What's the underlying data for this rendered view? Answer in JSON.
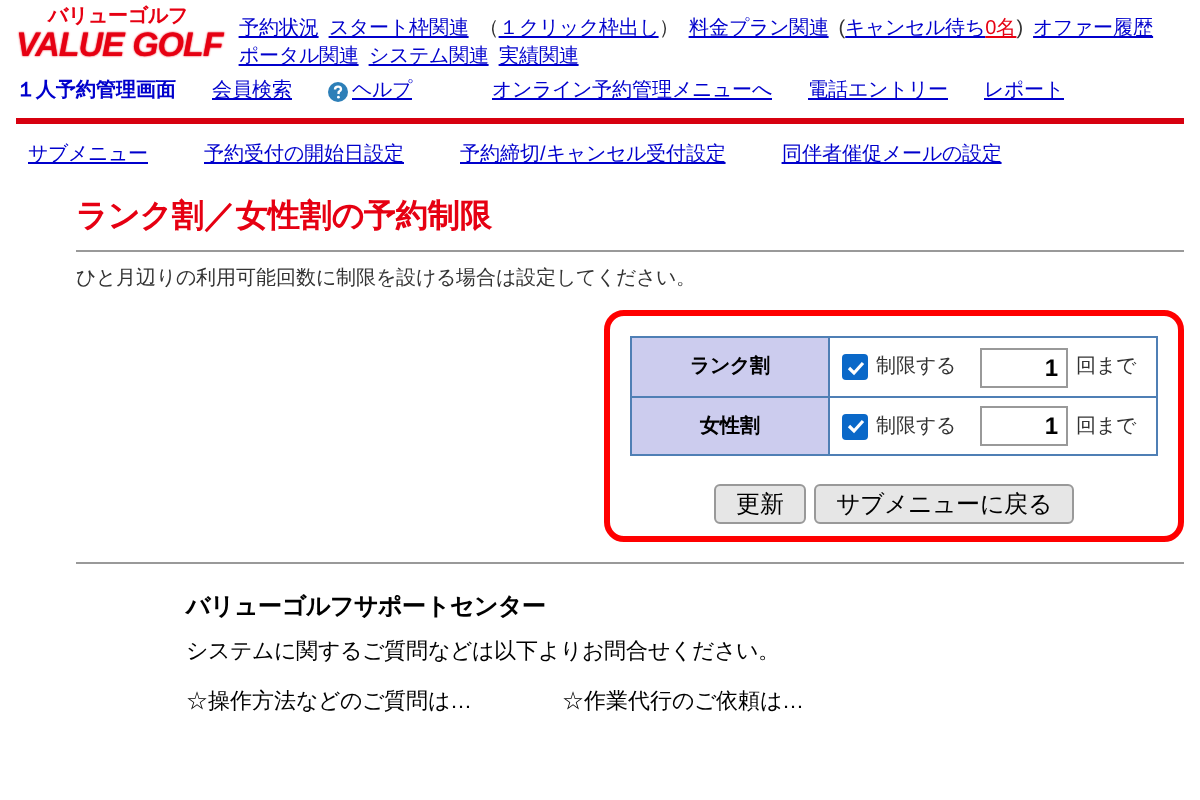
{
  "header": {
    "logo_sub": "バリューゴルフ",
    "logo": "VALUE GOLF",
    "nav": [
      {
        "label": "予約状況"
      },
      {
        "label": "スタート枠関連"
      },
      {
        "open": "（",
        "label": "１クリック枠出し",
        "close": "）"
      },
      {
        "label": "料金プラン関連"
      },
      {
        "label": "キャンセル待ち",
        "open": "(",
        "count": "0名",
        "close": ")"
      },
      {
        "label": "オファー履歴"
      },
      {
        "label": "ポータル関連"
      },
      {
        "label": "システム関連"
      },
      {
        "label": "実績関連"
      }
    ],
    "page_name": "１人予約管理画面",
    "links": [
      {
        "label": "会員検索"
      },
      {
        "label": "ヘルプ",
        "kind": "help"
      },
      {
        "label": "オンライン予約管理メニューへ"
      },
      {
        "label": "電話エントリー"
      },
      {
        "label": "レポート"
      }
    ]
  },
  "submenu": [
    "サブメニュー",
    "予約受付の開始日設定",
    "予約締切/キャンセル受付設定",
    "同伴者催促メールの設定"
  ],
  "title": "ランク割／女性割の予約制限",
  "description": "ひと月辺りの利用可能回数に制限を設ける場合は設定してください。",
  "limits": [
    {
      "label": "ランク割",
      "checked": true,
      "check_label": "制限する",
      "value": "1",
      "unit": "回まで"
    },
    {
      "label": "女性割",
      "checked": true,
      "check_label": "制限する",
      "value": "1",
      "unit": "回まで"
    }
  ],
  "buttons": [
    "更新",
    "サブメニューに戻る"
  ],
  "support": {
    "title": "バリューゴルフサポートセンター",
    "text": "システムに関するご質問などは以下よりお問合せください。",
    "items": [
      "☆操作方法などのご質問は…",
      "☆作業代行のご依頼は…"
    ]
  }
}
